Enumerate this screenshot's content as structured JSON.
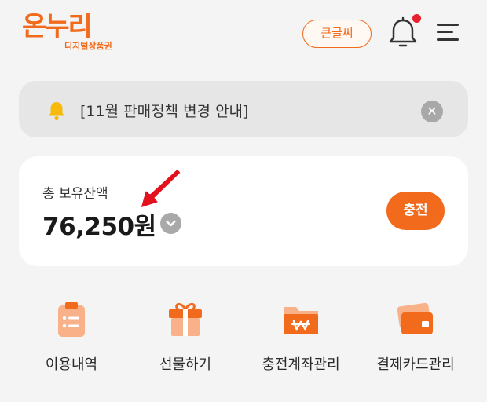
{
  "header": {
    "logo_main": "온누리",
    "logo_sub": "디지털상품권",
    "big_font_label": "큰글씨",
    "bell_icon": "bell-icon",
    "menu_icon": "hamburger-menu-icon"
  },
  "notice": {
    "icon": "bell-icon",
    "text": "[11월 판매정책 변경 안내]",
    "close_icon": "close-icon"
  },
  "balance": {
    "label": "총 보유잔액",
    "amount": "76,250원",
    "toggle_icon": "chevron-down-icon",
    "charge_label": "충전"
  },
  "quick_menu": [
    {
      "label": "이용내역",
      "icon": "clipboard-list-icon"
    },
    {
      "label": "선물하기",
      "icon": "gift-icon"
    },
    {
      "label": "충전계좌관리",
      "icon": "folder-won-icon"
    },
    {
      "label": "결제카드관리",
      "icon": "credit-card-icon"
    }
  ],
  "colors": {
    "accent": "#f26a1b",
    "accent_light": "#f9b18a",
    "notice_bg": "#e6e6e6",
    "alert_dot": "#e8202e",
    "annotation_arrow": "#e3101e"
  }
}
